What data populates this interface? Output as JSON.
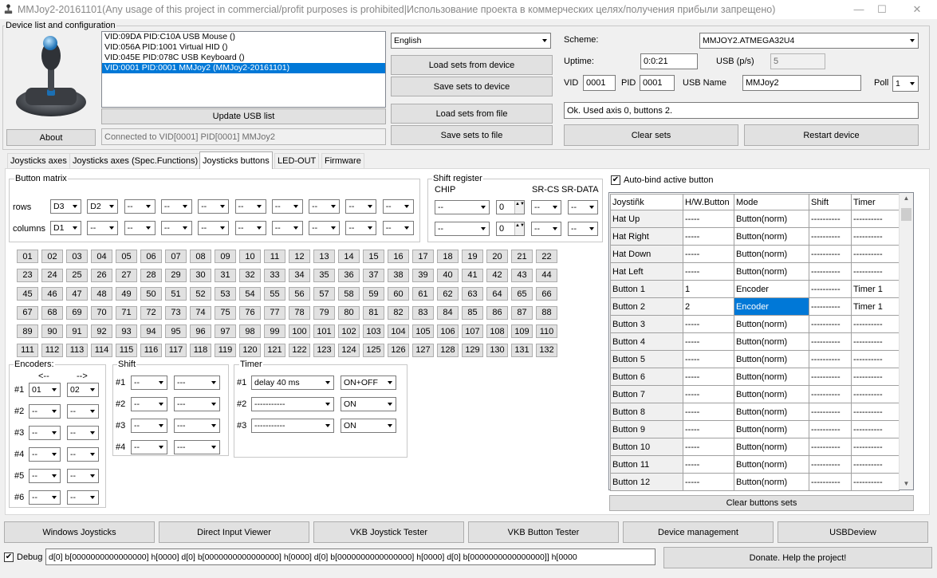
{
  "window": {
    "title": "MMJoy2-20161101(Any usage of this project in commercial/profit purposes is prohibited|Использование проекта в коммерческих целях/получения прибыли запрещено)",
    "minimize": "—",
    "maximize": "☐",
    "close": "✕"
  },
  "device_group": {
    "label": "Device list and configuration",
    "devices": [
      "VID:09DA PID:C10A USB Mouse ()",
      "VID:056A PID:1001 Virtual HID ()",
      "VID:045E PID:078C USB Keyboard ()",
      "VID:0001 PID:0001 MMJoy2 (MMJoy2-20161101)"
    ],
    "selected_index": 3,
    "about": "About",
    "update_usb": "Update USB list",
    "connected": "Connected to VID[0001] PID[0001] MMJoy2"
  },
  "language": {
    "value": "English"
  },
  "sets": {
    "load_device": "Load sets from device",
    "save_device": "Save sets to device",
    "load_file": "Load sets from file",
    "save_file": "Save sets to file"
  },
  "scheme": {
    "label": "Scheme:",
    "value": "MMJOY2.ATMEGA32U4",
    "uptime_label": "Uptime:",
    "uptime": "0:0:21",
    "usbps_label": "USB (p/s)",
    "usbps": "5",
    "vid_label": "VID",
    "vid": "0001",
    "pid_label": "PID",
    "pid": "0001",
    "usbname_label": "USB Name",
    "usbname": "MMJoy2",
    "poll_label": "Poll",
    "poll": "1",
    "status": "Ok. Used axis  0, buttons 2.",
    "clear_sets": "Clear sets",
    "restart": "Restart device"
  },
  "tabs": [
    "Joysticks axes",
    "Joysticks axes (Spec.Functions)",
    "Joysticks buttons",
    "LED-OUT",
    "Firmware"
  ],
  "matrix": {
    "label": "Button matrix",
    "rows_label": "rows",
    "columns_label": "columns",
    "rows": [
      "D3",
      "D2",
      "--",
      "--",
      "--",
      "--",
      "--",
      "--",
      "--",
      "--"
    ],
    "columns": [
      "D1",
      "--",
      "--",
      "--",
      "--",
      "--",
      "--",
      "--",
      "--",
      "--"
    ]
  },
  "shift_register": {
    "label": "Shift register",
    "chip_label": "CHIP",
    "srcs_label": "SR-CS",
    "srdata_label": "SR-DATA",
    "chip": [
      "--",
      "--"
    ],
    "count": [
      "0",
      "0"
    ],
    "cs": [
      "--",
      "--"
    ],
    "data": [
      "--",
      "--"
    ]
  },
  "buttons": [
    "01",
    "02",
    "03",
    "04",
    "05",
    "06",
    "07",
    "08",
    "09",
    "10",
    "11",
    "12",
    "13",
    "14",
    "15",
    "16",
    "17",
    "18",
    "19",
    "20",
    "21",
    "22",
    "23",
    "24",
    "25",
    "26",
    "27",
    "28",
    "29",
    "30",
    "31",
    "32",
    "33",
    "34",
    "35",
    "36",
    "37",
    "38",
    "39",
    "40",
    "41",
    "42",
    "43",
    "44",
    "45",
    "46",
    "47",
    "48",
    "49",
    "50",
    "51",
    "52",
    "53",
    "54",
    "55",
    "56",
    "57",
    "58",
    "59",
    "60",
    "61",
    "62",
    "63",
    "64",
    "65",
    "66",
    "67",
    "68",
    "69",
    "70",
    "71",
    "72",
    "73",
    "74",
    "75",
    "76",
    "77",
    "78",
    "79",
    "80",
    "81",
    "82",
    "83",
    "84",
    "85",
    "86",
    "87",
    "88",
    "89",
    "90",
    "91",
    "92",
    "93",
    "94",
    "95",
    "96",
    "97",
    "98",
    "99",
    "100",
    "101",
    "102",
    "103",
    "104",
    "105",
    "106",
    "107",
    "108",
    "109",
    "110",
    "111",
    "112",
    "113",
    "114",
    "115",
    "116",
    "117",
    "118",
    "119",
    "120",
    "121",
    "122",
    "123",
    "124",
    "125",
    "126",
    "127",
    "128",
    "129",
    "130",
    "131",
    "132"
  ],
  "encoders": {
    "label": "Encoders:",
    "left_arrow": "<--",
    "right_arrow": "-->",
    "rows": [
      {
        "n": "#1",
        "a": "01",
        "b": "02"
      },
      {
        "n": "#2",
        "a": "--",
        "b": "--"
      },
      {
        "n": "#3",
        "a": "--",
        "b": "--"
      },
      {
        "n": "#4",
        "a": "--",
        "b": "--"
      },
      {
        "n": "#5",
        "a": "--",
        "b": "--"
      },
      {
        "n": "#6",
        "a": "--",
        "b": "--"
      }
    ]
  },
  "shift": {
    "label": "Shift",
    "rows": [
      {
        "n": "#1",
        "a": "--",
        "b": "---"
      },
      {
        "n": "#2",
        "a": "--",
        "b": "---"
      },
      {
        "n": "#3",
        "a": "--",
        "b": "---"
      },
      {
        "n": "#4",
        "a": "--",
        "b": "---"
      }
    ]
  },
  "timer": {
    "label": "Timer",
    "rows": [
      {
        "n": "#1",
        "a": "delay 40 ms",
        "b": "ON+OFF"
      },
      {
        "n": "#2",
        "a": "-----------",
        "b": "ON"
      },
      {
        "n": "#3",
        "a": "-----------",
        "b": "ON"
      }
    ]
  },
  "autobind": {
    "label": "Auto-bind active button",
    "checked": "✔"
  },
  "jtable": {
    "headers": [
      "Joystiñk",
      "H/W.Button",
      "Mode",
      "Shift",
      "Timer"
    ],
    "rows": [
      [
        "Hat Up",
        "-----",
        "Button(norm)",
        "----------",
        "----------"
      ],
      [
        "Hat Right",
        "-----",
        "Button(norm)",
        "----------",
        "----------"
      ],
      [
        "Hat Down",
        "-----",
        "Button(norm)",
        "----------",
        "----------"
      ],
      [
        "Hat Left",
        "-----",
        "Button(norm)",
        "----------",
        "----------"
      ],
      [
        "Button 1",
        "1",
        "Encoder",
        "----------",
        "Timer 1"
      ],
      [
        "Button 2",
        "2",
        "Encoder",
        "----------",
        "Timer 1"
      ],
      [
        "Button 3",
        "-----",
        "Button(norm)",
        "----------",
        "----------"
      ],
      [
        "Button 4",
        "-----",
        "Button(norm)",
        "----------",
        "----------"
      ],
      [
        "Button 5",
        "-----",
        "Button(norm)",
        "----------",
        "----------"
      ],
      [
        "Button 6",
        "-----",
        "Button(norm)",
        "----------",
        "----------"
      ],
      [
        "Button 7",
        "-----",
        "Button(norm)",
        "----------",
        "----------"
      ],
      [
        "Button 8",
        "-----",
        "Button(norm)",
        "----------",
        "----------"
      ],
      [
        "Button 9",
        "-----",
        "Button(norm)",
        "----------",
        "----------"
      ],
      [
        "Button 10",
        "-----",
        "Button(norm)",
        "----------",
        "----------"
      ],
      [
        "Button 11",
        "-----",
        "Button(norm)",
        "----------",
        "----------"
      ],
      [
        "Button 12",
        "-----",
        "Button(norm)",
        "----------",
        "----------"
      ]
    ],
    "clear_buttons": "Clear buttons sets"
  },
  "bottom": [
    "Windows Joysticks",
    "Direct Input Viewer",
    "VKB Joystick Tester",
    "VKB Button Tester",
    "Device management",
    "USBDeview"
  ],
  "debug": {
    "label": "Debug",
    "checked": "✔",
    "text": "d[0] b[0000000000000000] h[0000]   d[0] b[0000000000000000] h[0000]   d[0] b[0000000000000000] h[0000]   d[0] b[0000000000000000]] h[0000",
    "donate": "Donate. Help the project!"
  }
}
